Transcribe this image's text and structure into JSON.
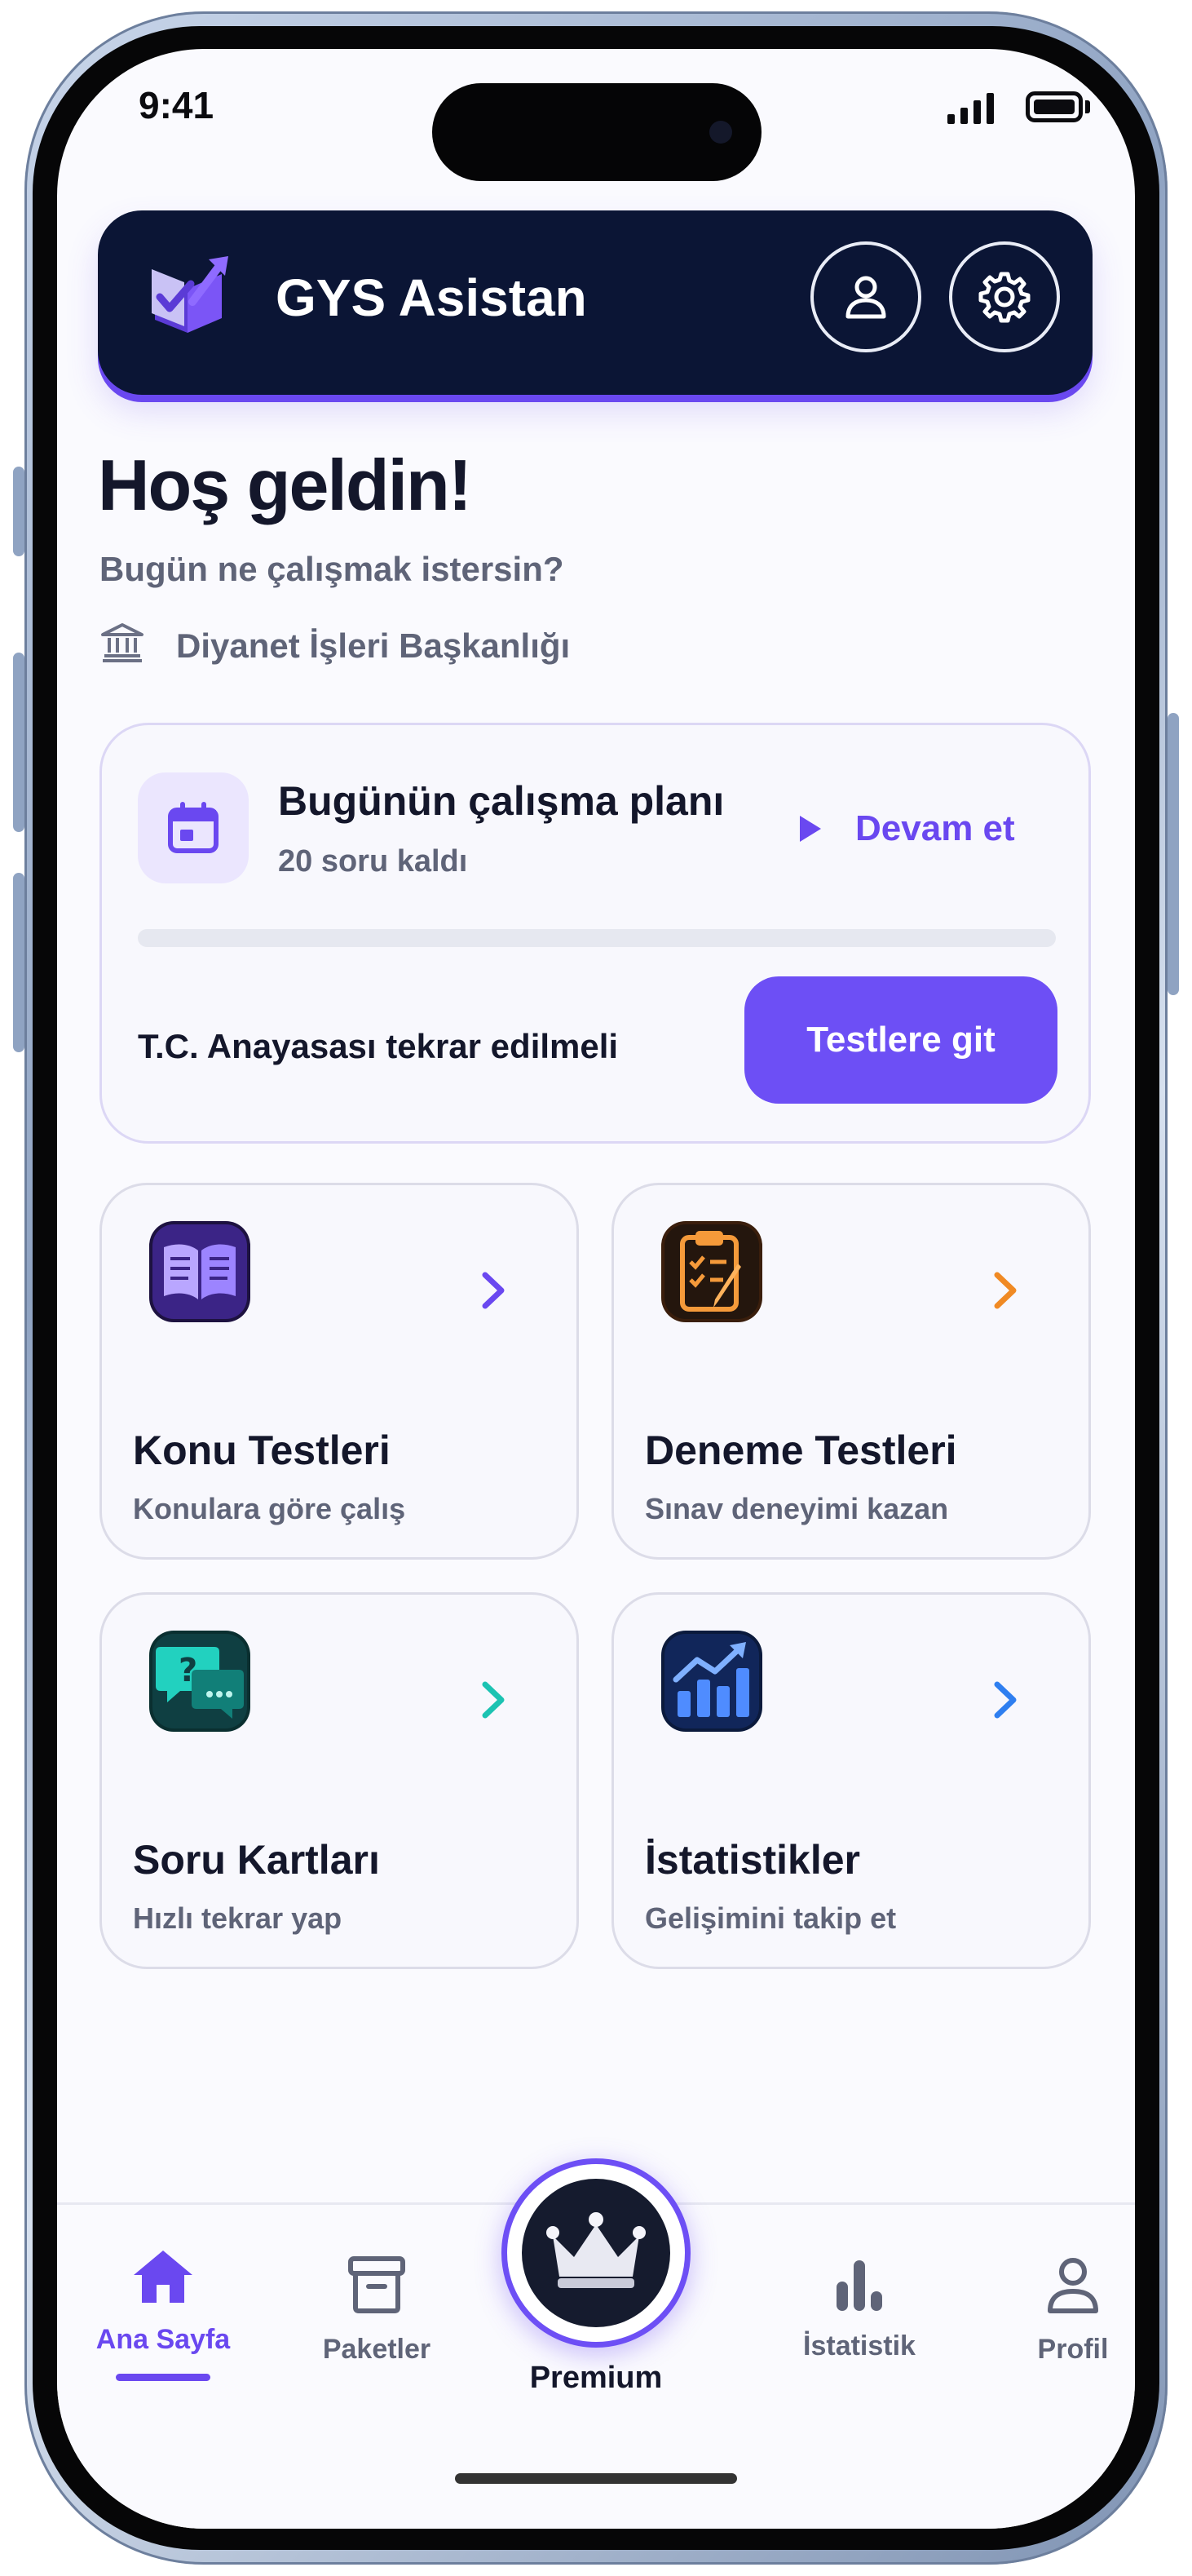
{
  "status_bar": {
    "time": "9:41"
  },
  "header": {
    "title": "GYS Asistan",
    "profile_icon": "user-icon",
    "settings_icon": "gear-icon"
  },
  "welcome": {
    "title": "Hoş geldin!",
    "subtitle": "Bugün ne çalışmak istersin?",
    "institution": "Diyanet İşleri Başkanlığı"
  },
  "plan": {
    "title": "Bugünün çalışma planı",
    "remaining": "20 soru kaldı",
    "continue_label": "Devam et",
    "progress": 0,
    "note": "T.C. Anayasası tekrar edilmeli",
    "tests_button": "Testlere git"
  },
  "features": [
    {
      "title": "Konu Testleri",
      "subtitle": "Konulara göre çalış",
      "icon": "book-icon",
      "accent": "#6a48f0"
    },
    {
      "title": "Deneme Testleri",
      "subtitle": "Sınav deneyimi kazan",
      "icon": "clipboard-icon",
      "accent": "#f08a24"
    },
    {
      "title": "Soru Kartları",
      "subtitle": "Hızlı tekrar yap",
      "icon": "chat-question-icon",
      "accent": "#1cc3b2"
    },
    {
      "title": "İstatistikler",
      "subtitle": "Gelişimini takip et",
      "icon": "chart-icon",
      "accent": "#2f7ff0"
    }
  ],
  "nav": {
    "home": "Ana Sayfa",
    "packages": "Paketler",
    "premium": "Premium",
    "stats": "İstatistik",
    "profile": "Profil"
  },
  "colors": {
    "accent": "#6a48f0",
    "header_bg": "#0b1535"
  }
}
